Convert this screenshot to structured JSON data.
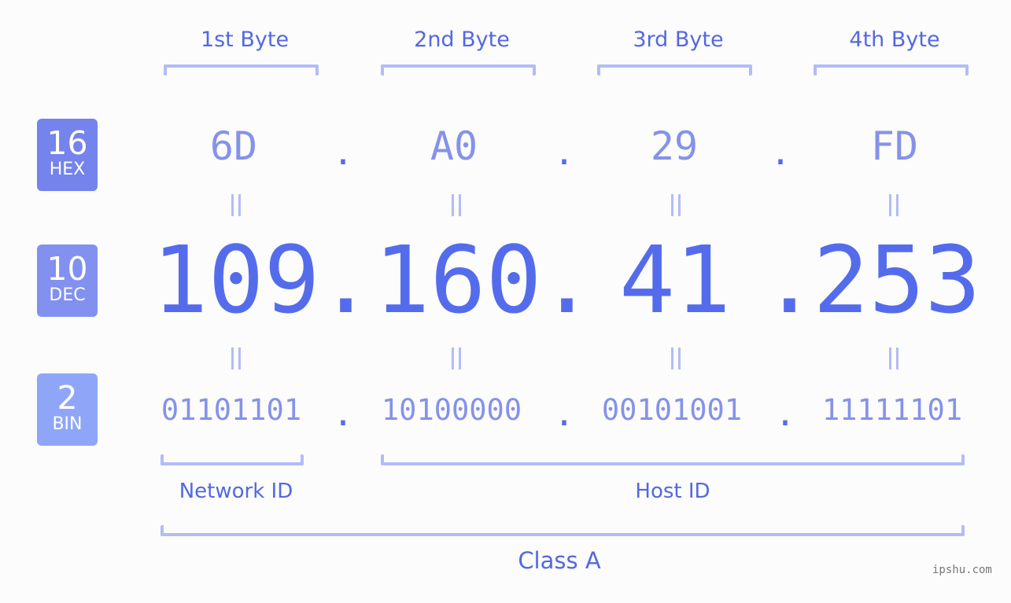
{
  "bytes": [
    {
      "label": "1st Byte",
      "hex": "6D",
      "dec": "109",
      "bin": "01101101"
    },
    {
      "label": "2nd Byte",
      "hex": "A0",
      "dec": "160",
      "bin": "10100000"
    },
    {
      "label": "3rd Byte",
      "hex": "29",
      "dec": "41",
      "bin": "00101001"
    },
    {
      "label": "4th Byte",
      "hex": "FD",
      "dec": "253",
      "bin": "11111101"
    }
  ],
  "separator": ".",
  "badges": {
    "hex": {
      "num": "16",
      "label": "HEX",
      "color": "#7583ec"
    },
    "dec": {
      "num": "10",
      "label": "DEC",
      "color": "#8290f0"
    },
    "bin": {
      "num": "2",
      "label": "BIN",
      "color": "#8fa6f8"
    }
  },
  "segments": {
    "network": "Network ID",
    "host": "Host ID",
    "class": "Class A"
  },
  "colors": {
    "accent": "#546cec",
    "light_value": "#8592ea",
    "bracket": "#b3bcf7"
  },
  "watermark": "ipshu.com"
}
